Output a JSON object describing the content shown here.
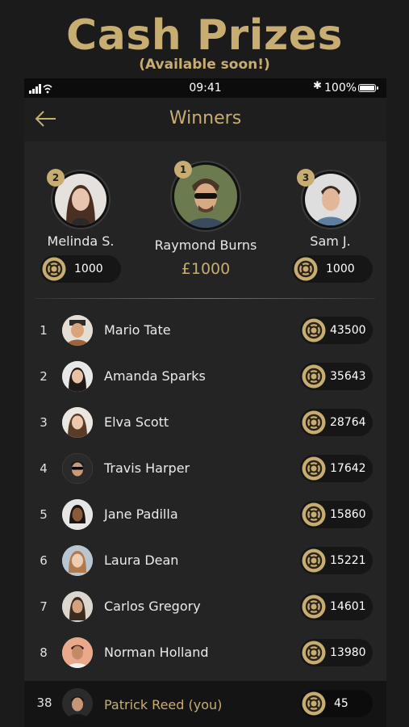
{
  "promo": {
    "title": "Cash Prizes",
    "subtitle": "(Available soon!)"
  },
  "status_bar": {
    "time": "09:41",
    "battery": "100%"
  },
  "header": {
    "title": "Winners"
  },
  "podium": [
    {
      "rank": "2",
      "name": "Melinda S.",
      "value": "1000",
      "type": "coins"
    },
    {
      "rank": "1",
      "name": "Raymond Burns",
      "value": "£1000",
      "type": "cash"
    },
    {
      "rank": "3",
      "name": "Sam J.",
      "value": "1000",
      "type": "coins"
    }
  ],
  "leaderboard": [
    {
      "rank": "1",
      "name": "Mario Tate",
      "score": "43500"
    },
    {
      "rank": "2",
      "name": "Amanda Sparks",
      "score": "35643"
    },
    {
      "rank": "3",
      "name": "Elva Scott",
      "score": "28764"
    },
    {
      "rank": "4",
      "name": "Travis Harper",
      "score": "17642"
    },
    {
      "rank": "5",
      "name": "Jane Padilla",
      "score": "15860"
    },
    {
      "rank": "6",
      "name": "Laura Dean",
      "score": "15221"
    },
    {
      "rank": "7",
      "name": "Carlos Gregory",
      "score": "14601"
    },
    {
      "rank": "8",
      "name": "Norman Holland",
      "score": "13980"
    }
  ],
  "current_user": {
    "rank": "38",
    "name": "Patrick Reed (you)",
    "score": "45"
  },
  "colors": {
    "accent": "#c8ad73",
    "background": "#242424",
    "pill": "#161616"
  }
}
